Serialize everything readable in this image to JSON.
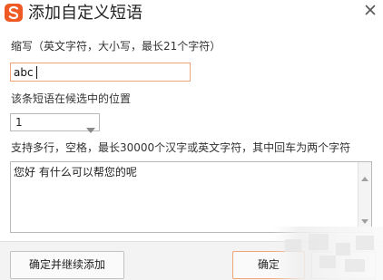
{
  "dialog": {
    "title": "添加自定义短语",
    "brand_color": "#ef5a24",
    "accent_border": "#f2a477"
  },
  "abbreviation": {
    "label": "缩写（英文字符，大小写，最长21个字符）",
    "value": "abc"
  },
  "position": {
    "label": "该条短语在候选中的位置",
    "selected": "1"
  },
  "phrase": {
    "label": "支持多行，空格，最长30000个汉字或英文字符，其中回车为两个字符",
    "value": "您好 有什么可以帮您的呢"
  },
  "footer": {
    "continue_label": "确定并继续添加",
    "ok_label": "确定",
    "cancel_label": ""
  },
  "icons": {
    "logo": "sogou-s-logo-icon",
    "close": "close-icon",
    "dropdown": "chevron-down-icon",
    "scroll_up": "scroll-up-arrow-icon",
    "scroll_down": "scroll-down-arrow-icon"
  }
}
